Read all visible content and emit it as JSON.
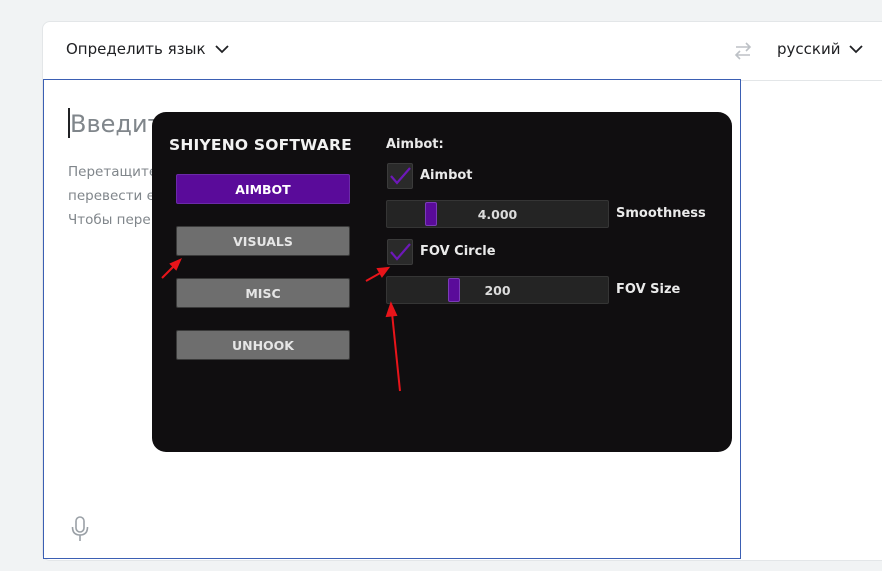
{
  "translator": {
    "source_language": "Определить язык",
    "target_language": "русский",
    "placeholder": "Введите",
    "hint_lines": [
      "Перетащите",
      "перевести е",
      "Чтобы пере"
    ]
  },
  "overlay": {
    "brand": "SHIYENO SOFTWARE",
    "menu": [
      {
        "label": "AIMBOT",
        "active": true
      },
      {
        "label": "VISUALS",
        "active": false
      },
      {
        "label": "MISC",
        "active": false
      },
      {
        "label": "UNHOOK",
        "active": false
      }
    ],
    "section_title": "Aimbot:",
    "aimbot_checkbox": {
      "label": "Aimbot",
      "checked": true
    },
    "smoothness": {
      "value": "4.000",
      "label": "Smoothness",
      "fraction": 0.18
    },
    "fov_checkbox": {
      "label": "FOV Circle",
      "checked": true
    },
    "fov_size": {
      "value": "200",
      "label": "FOV Size",
      "fraction": 0.29
    }
  },
  "colors": {
    "accent": "#5a0b9a",
    "panel": "#100e10",
    "annotation": "#e8141a"
  }
}
